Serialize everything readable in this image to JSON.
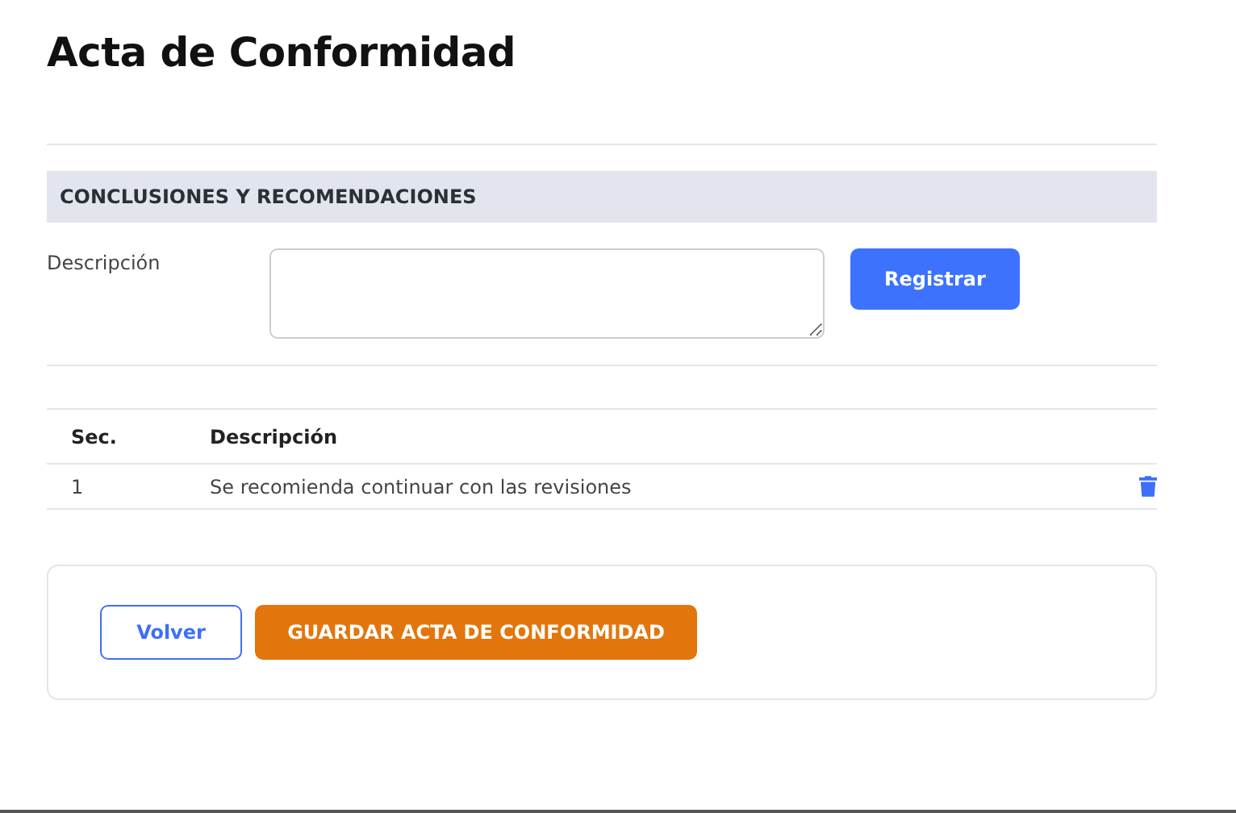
{
  "page_title": "Acta de Conformidad",
  "section": {
    "title": "CONCLUSIONES Y RECOMENDACIONES"
  },
  "form": {
    "label": "Descripción",
    "submit": "Registrar"
  },
  "table": {
    "columns": [
      "Sec.",
      "Descripción"
    ],
    "rows": [
      {
        "sec": "1",
        "description": "Se recomienda continuar con las revisiones"
      }
    ]
  },
  "actions": {
    "back": "Volver",
    "save": "GUARDAR ACTA DE CONFORMIDAD"
  }
}
